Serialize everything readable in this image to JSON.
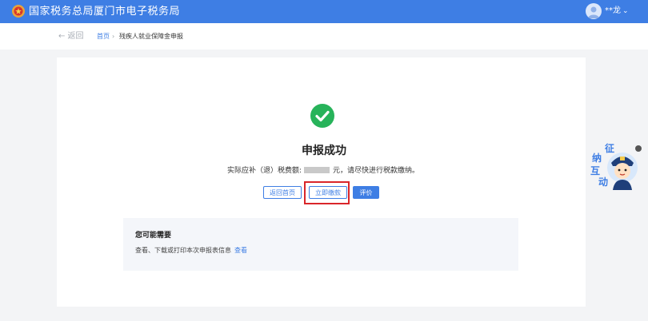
{
  "header": {
    "site_title": "国家税务总局厦门市电子税务局",
    "user_name": "**龙",
    "user_caret": "⌄",
    "brand_color": "#3e7ee4",
    "emblem_icon": "tax-emblem-icon",
    "avatar_icon": "user-avatar-icon"
  },
  "breadcrumb": {
    "back_label": "← 返回",
    "home": "首页",
    "separator": "›",
    "current": "残疾人就业保障金申报"
  },
  "result": {
    "icon": "check-circle-icon",
    "title": "申报成功",
    "amount_prefix": "实际应补（退）税费额:",
    "amount_suffix": "元，请尽快进行税款缴纳。",
    "success_color": "#27b35a"
  },
  "buttons": {
    "home": "返回首页",
    "pay": "立即缴款",
    "rate": "评价"
  },
  "need": {
    "title": "您可能需要",
    "text": "查看、下载或打印本次申报表信息",
    "link": "查看"
  },
  "mascot": {
    "chars": [
      "征",
      "纳",
      "互",
      "动"
    ],
    "icon": "tax-officer-mascot-icon"
  }
}
